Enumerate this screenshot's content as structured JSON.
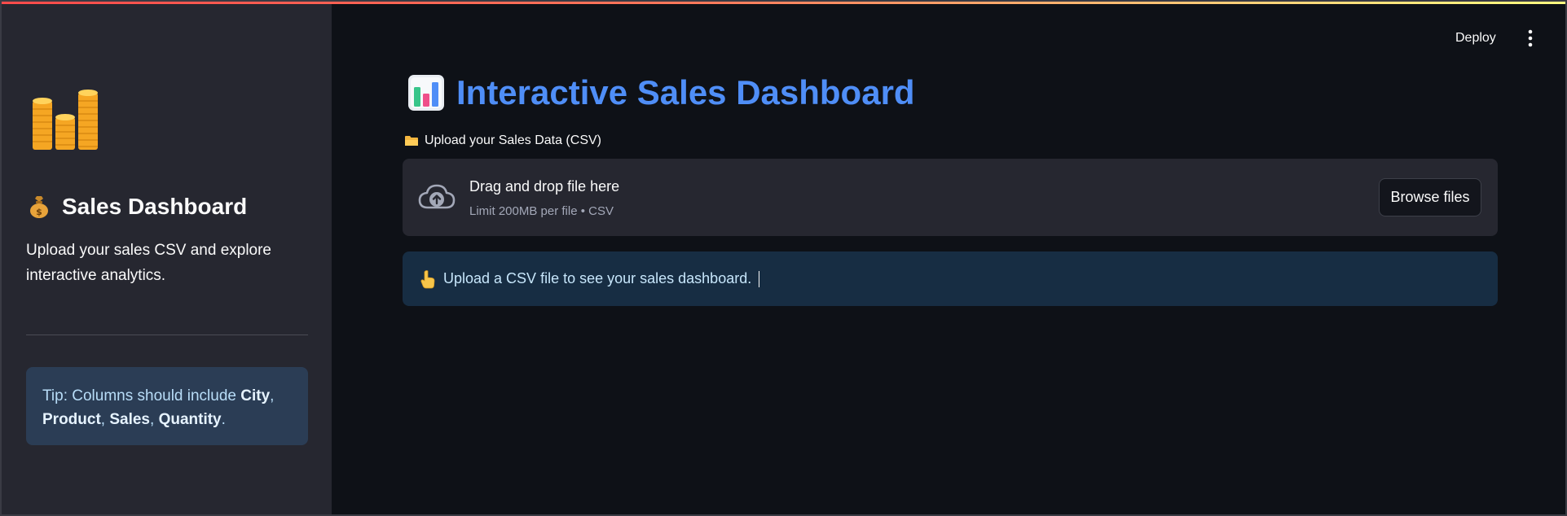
{
  "sidebar": {
    "logo_icon": "stacked-coins-icon",
    "title_icon": "money-bag-icon",
    "title": "Sales Dashboard",
    "description": "Upload your sales CSV and explore interactive analytics.",
    "tip": {
      "prefix": "Tip: Columns should include ",
      "columns": [
        "City",
        "Product",
        "Sales",
        "Quantity"
      ],
      "sep1": ", ",
      "sep2": ", ",
      "sep3": ", ",
      "suffix": "."
    }
  },
  "header": {
    "deploy_label": "Deploy",
    "menu_icon": "kebab-menu-icon"
  },
  "main": {
    "title_icon": "bar-chart-icon",
    "title": "Interactive Sales Dashboard",
    "upload_label": "Upload your Sales Data (CSV)",
    "uploader": {
      "icon": "cloud-upload-icon",
      "main_text": "Drag and drop file here",
      "sub_text": "Limit 200MB per file • CSV",
      "button_label": "Browse files"
    },
    "info": {
      "icon": "pointing-hand-icon",
      "text": "Upload a CSV file to see your sales dashboard."
    }
  },
  "colors": {
    "accent": "#4f8ef7",
    "sidebar_bg": "#262730",
    "main_bg": "#0e1117",
    "info_bg": "#172d43",
    "tip_bg": "#2b3d55"
  }
}
